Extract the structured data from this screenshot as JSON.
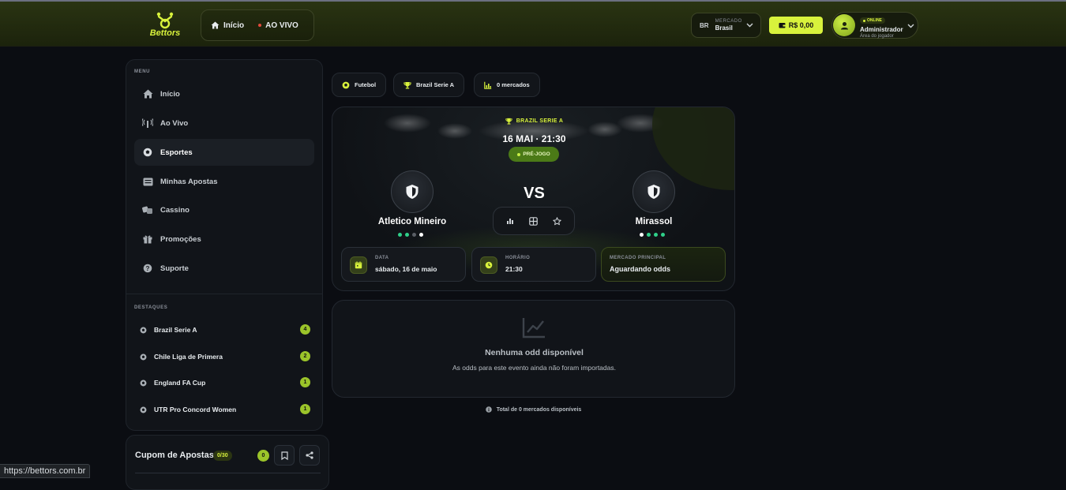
{
  "header": {
    "logo_text": "Bettors",
    "nav": [
      {
        "label": "Início",
        "icon": "home-icon"
      },
      {
        "label": "AO VIVO",
        "icon": "live-dot"
      }
    ],
    "market": {
      "code": "BR",
      "label": "MERCADO",
      "value": "Brasil"
    },
    "balance": "R$ 0,00",
    "user": {
      "status": "ONLINE",
      "name": "Administrador",
      "subtitle": "Área do jogador"
    }
  },
  "sidebar": {
    "menu_label": "MENU",
    "menu": [
      {
        "label": "Início",
        "icon": "home-icon"
      },
      {
        "label": "Ao Vivo",
        "icon": "broadcast-icon"
      },
      {
        "label": "Esportes",
        "icon": "soccer-ball-icon",
        "active": true
      },
      {
        "label": "Minhas Apostas",
        "icon": "list-icon"
      },
      {
        "label": "Cassino",
        "icon": "dice-icon"
      },
      {
        "label": "Promoções",
        "icon": "gift-icon"
      },
      {
        "label": "Suporte",
        "icon": "help-icon"
      }
    ],
    "highlights_label": "DESTAQUES",
    "highlights": [
      {
        "label": "Brazil Serie A",
        "count": "4"
      },
      {
        "label": "Chile Liga de Primera",
        "count": "2"
      },
      {
        "label": "England FA Cup",
        "count": "1"
      },
      {
        "label": "UTR Pro Concord Women",
        "count": "1"
      }
    ]
  },
  "coupon": {
    "title": "Cupom de Apostas",
    "tag": "0/30",
    "count": "0"
  },
  "chips": [
    {
      "label": "Futebol",
      "icon": "soccer-ball-icon"
    },
    {
      "label": "Brazil Serie A",
      "icon": "trophy-icon"
    },
    {
      "label": "0 mercados",
      "icon": "bar-chart-icon"
    }
  ],
  "match": {
    "league": "BRAZIL SERIE A",
    "kickoff": "16 MAI · 21:30",
    "status": "PRÉ-JOGO",
    "vs": "VS",
    "home": {
      "name": "Atletico Mineiro",
      "form": [
        "#2fd08a",
        "#2fd08a",
        "#5a5f66",
        "#ffffff"
      ]
    },
    "away": {
      "name": "Mirassol",
      "form": [
        "#ffffff",
        "#2fd08a",
        "#2fd08a",
        "#2fd08a"
      ]
    },
    "info": {
      "date_label": "DATA",
      "date_value": "sábado, 16 de maio",
      "time_label": "HORÁRIO",
      "time_value": "21:30",
      "market_label": "MERCADO PRINCIPAL",
      "market_value": "Aguardando odds"
    }
  },
  "odds": {
    "empty_title": "Nenhuma odd disponível",
    "empty_text": "As odds para este evento ainda não foram importadas.",
    "total": "Total de 0 mercados disponíveis"
  },
  "statusbar": {
    "url": "https://bettors.com.br"
  },
  "colors": {
    "accent": "#d8f23c",
    "bg": "#0b0d12",
    "card": "#111419",
    "form_win": "#2fd08a"
  }
}
